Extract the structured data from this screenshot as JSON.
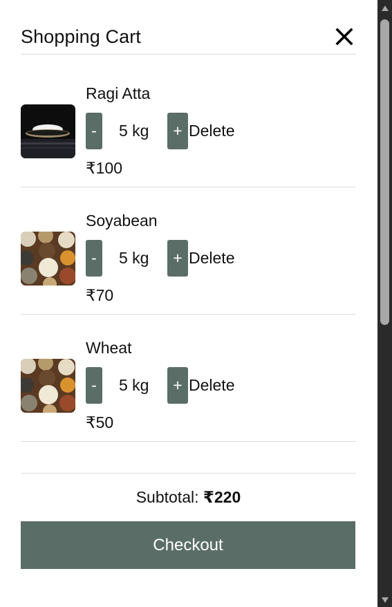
{
  "cart": {
    "title": "Shopping Cart",
    "close_icon": "close-icon",
    "items": [
      {
        "name": "Ragi Atta",
        "quantity": "5 kg",
        "minus_label": "-",
        "plus_label": "+",
        "delete_label": "Delete",
        "price": "₹100",
        "image": "flour-bowl-image"
      },
      {
        "name": "Soyabean",
        "quantity": "5 kg",
        "minus_label": "-",
        "plus_label": "+",
        "delete_label": "Delete",
        "price": "₹70",
        "image": "grains-bowls-image"
      },
      {
        "name": "Wheat",
        "quantity": "5 kg",
        "minus_label": "-",
        "plus_label": "+",
        "delete_label": "Delete",
        "price": "₹50",
        "image": "grains-bowls-image"
      }
    ],
    "subtotal_label": "Subtotal:",
    "subtotal_value": "₹220",
    "checkout_label": "Checkout"
  },
  "colors": {
    "accent": "#5a6e67",
    "divider": "#dcdcdc",
    "scrollbar_track": "#2a2a2a",
    "scrollbar_thumb": "#a8a8a8"
  }
}
